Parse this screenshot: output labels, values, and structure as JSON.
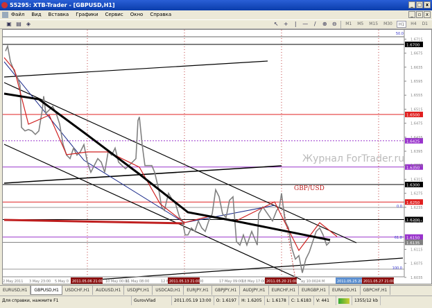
{
  "window": {
    "title": "55295: XTB-Trader - [GBPUSD,H1]",
    "controls": [
      "_",
      "□",
      "x"
    ],
    "mdi_controls": [
      "_",
      "▫",
      "x"
    ]
  },
  "menu": [
    "Файл",
    "Вид",
    "Вставка",
    "Графики",
    "Сервис",
    "Окно",
    "Справка"
  ],
  "timeframes": [
    "M1",
    "M5",
    "M15",
    "M30",
    "H1",
    "H4",
    "D1"
  ],
  "active_timeframe": "H1",
  "chart": {
    "symbol_label": "GBP/USD",
    "watermark": "Журнал ForTrader.ru",
    "price_ticks": [
      "1.6715",
      "1.6675",
      "1.6635",
      "1.6595",
      "1.6555",
      "1.6515",
      "1.6475",
      "1.6435",
      "1.6395",
      "1.6355",
      "1.6315",
      "1.6275",
      "1.6235",
      "1.6195",
      "1.6115",
      "1.6075",
      "1.6035"
    ],
    "levels": [
      {
        "price": 1.67,
        "label": "1.6700",
        "color": "#000000",
        "style": "solid"
      },
      {
        "price": 1.65,
        "label": "1.6500",
        "color": "#e02020",
        "style": "solid"
      },
      {
        "price": 1.6425,
        "label": "1.6425",
        "color": "#9933cc",
        "style": "dotted"
      },
      {
        "price": 1.635,
        "label": "1.6350",
        "color": "#9933cc",
        "style": "solid"
      },
      {
        "price": 1.63,
        "label": "1.6300",
        "color": "#000000",
        "style": "solid"
      },
      {
        "price": 1.625,
        "label": "1.6250",
        "color": "#e02020",
        "style": "solid"
      },
      {
        "price": 1.62,
        "label": "1.6200",
        "color": "#000000",
        "style": "solid"
      },
      {
        "price": 1.615,
        "label": "1.6150",
        "color": "#9933cc",
        "style": "solid"
      },
      {
        "price": 1.6135,
        "label": "1.6135",
        "color": "#808080",
        "style": "solid"
      }
    ],
    "fibo_labels": [
      "50.0",
      "0.0",
      "61.8",
      "100.0"
    ],
    "time_labels": [
      "2 May 2011",
      "3 May 23:00",
      "5 May 0",
      "10 May 00:00",
      "11 May 08:00",
      "12 M",
      "01:00",
      "17 May 09:00",
      "18 May 17:00",
      "ay 10:00",
      "24 M"
    ],
    "time_markers": [
      {
        "label": "2011.05.06 21:00",
        "color": "#8b1010"
      },
      {
        "label": "2011.05.13 21:00",
        "color": "#8b1010"
      },
      {
        "label": "2011.05.20 21:00",
        "color": "#8b1010"
      },
      {
        "label": "2011.05.25 2011.05.2",
        "color": "#5b8fd0"
      },
      {
        "label": "2011.05.27 21:00",
        "color": "#8b1010"
      }
    ],
    "price_path": [
      [
        0,
        1.6681
      ],
      [
        3,
        1.6695
      ],
      [
        7,
        1.6651
      ],
      [
        13,
        1.6622
      ],
      [
        18,
        1.6602
      ],
      [
        21,
        1.6582
      ],
      [
        23,
        1.6463
      ],
      [
        28,
        1.6453
      ],
      [
        33,
        1.6457
      ],
      [
        38,
        1.6453
      ],
      [
        43,
        1.6443
      ],
      [
        48,
        1.6453
      ],
      [
        53,
        1.6513
      ],
      [
        55,
        1.6552
      ],
      [
        58,
        1.6503
      ],
      [
        63,
        1.6513
      ],
      [
        68,
        1.6523
      ],
      [
        73,
        1.6503
      ],
      [
        78,
        1.6473
      ],
      [
        83,
        1.6414
      ],
      [
        88,
        1.6384
      ],
      [
        93,
        1.6374
      ],
      [
        98,
        1.6404
      ],
      [
        103,
        1.6384
      ],
      [
        108,
        1.6394
      ],
      [
        113,
        1.6414
      ],
      [
        118,
        1.6364
      ],
      [
        123,
        1.6335
      ],
      [
        133,
        1.6374
      ],
      [
        138,
        1.6364
      ],
      [
        143,
        1.6335
      ],
      [
        148,
        1.6394
      ],
      [
        153,
        1.6384
      ],
      [
        158,
        1.6404
      ],
      [
        163,
        1.6364
      ],
      [
        168,
        1.6354
      ],
      [
        173,
        1.6345
      ],
      [
        178,
        1.6354
      ],
      [
        183,
        1.6364
      ],
      [
        188,
        1.6374
      ],
      [
        191,
        1.6483
      ],
      [
        193,
        1.6493
      ],
      [
        197,
        1.6414
      ],
      [
        201,
        1.6354
      ],
      [
        205,
        1.6354
      ],
      [
        211,
        1.6354
      ],
      [
        215,
        1.6335
      ],
      [
        221,
        1.6285
      ],
      [
        225,
        1.6236
      ],
      [
        229,
        1.6226
      ],
      [
        235,
        1.6275
      ],
      [
        241,
        1.6255
      ],
      [
        245,
        1.6246
      ],
      [
        251,
        1.6206
      ],
      [
        255,
        1.6196
      ],
      [
        259,
        1.6156
      ],
      [
        263,
        1.6156
      ],
      [
        268,
        1.6176
      ],
      [
        273,
        1.6166
      ],
      [
        278,
        1.6196
      ],
      [
        283,
        1.6176
      ],
      [
        288,
        1.6166
      ],
      [
        293,
        1.6196
      ],
      [
        298,
        1.6216
      ],
      [
        303,
        1.6285
      ],
      [
        308,
        1.6265
      ],
      [
        313,
        1.6216
      ],
      [
        318,
        1.6206
      ],
      [
        323,
        1.6255
      ],
      [
        328,
        1.6265
      ],
      [
        333,
        1.6137
      ],
      [
        338,
        1.6127
      ],
      [
        343,
        1.6156
      ],
      [
        348,
        1.6127
      ],
      [
        355,
        1.6166
      ],
      [
        363,
        1.6127
      ],
      [
        365,
        1.6216
      ],
      [
        371,
        1.6236
      ],
      [
        378,
        1.6216
      ],
      [
        385,
        1.6196
      ],
      [
        391,
        1.6226
      ],
      [
        395,
        1.6236
      ],
      [
        398,
        1.6275
      ],
      [
        403,
        1.6196
      ],
      [
        408,
        1.6176
      ],
      [
        413,
        1.6117
      ],
      [
        418,
        1.6087
      ],
      [
        423,
        1.6097
      ],
      [
        428,
        1.6048
      ],
      [
        433,
        1.6087
      ],
      [
        438,
        1.6107
      ],
      [
        443,
        1.6137
      ],
      [
        448,
        1.6166
      ],
      [
        453,
        1.6176
      ],
      [
        458,
        1.6156
      ],
      [
        463,
        1.6127
      ],
      [
        468,
        1.6137
      ]
    ]
  },
  "tabs": [
    "EURUSD,H1",
    "GBPUSD,H1",
    "USDCHF,H1",
    "AUDUSD,H1",
    "USDJPY,H1",
    "USDCAD,H1",
    "EURJPY,H1",
    "GBPJPY,H1",
    "AUDJPY,H1",
    "EURCHF,H1",
    "EURGBP,H1",
    "EURAUD,H1",
    "GBPCHF,H1"
  ],
  "active_tab": "GBPUSD,H1",
  "status": {
    "help": "Для справки, нажмите F1",
    "profile": "GurovVlad",
    "time": "2011.05.19 13:00",
    "open": "O: 1.6197",
    "high": "H: 1.6205",
    "low": "L: 1.6178",
    "close": "C: 1.6183",
    "volume": "V: 441",
    "traffic": "1355/12 kb"
  }
}
